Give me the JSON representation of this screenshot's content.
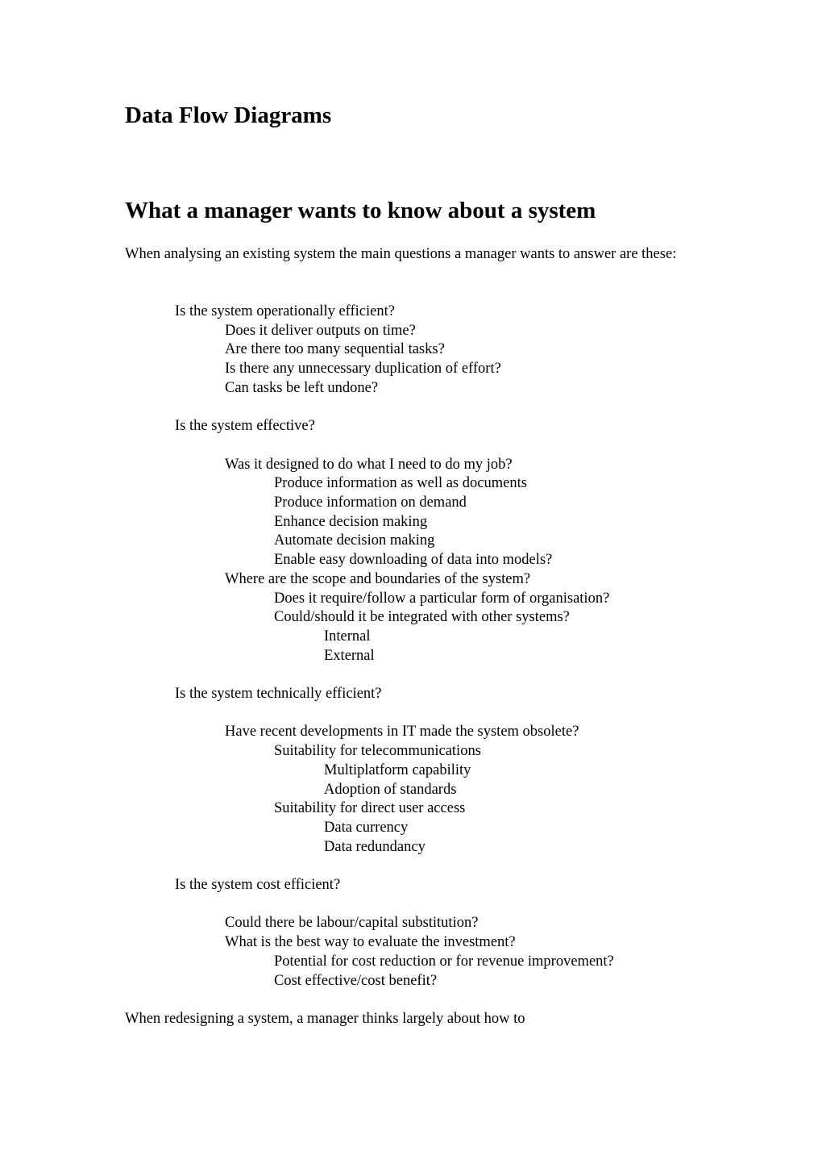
{
  "document": {
    "title": "Data Flow Diagrams",
    "section_heading": "What a manager wants to know about a system",
    "intro": "When analysing an existing system the main questions a manager wants to answer are these:",
    "outline": [
      {
        "level": 1,
        "line": 0,
        "text": "Is the system operationally efficient?"
      },
      {
        "level": 2,
        "line": 1,
        "text": "Does it deliver outputs on time?"
      },
      {
        "level": 2,
        "line": 2,
        "text": "Are there too many sequential tasks?"
      },
      {
        "level": 2,
        "line": 3,
        "text": "Is there any unnecessary duplication of effort?"
      },
      {
        "level": 2,
        "line": 4,
        "text": "Can tasks be left undone?"
      },
      {
        "level": 1,
        "line": 6,
        "text": "Is the system effective?"
      },
      {
        "level": 2,
        "line": 8,
        "text": "Was it designed to do what I need to do my job?"
      },
      {
        "level": 3,
        "line": 9,
        "text": "Produce information as well as documents"
      },
      {
        "level": 3,
        "line": 10,
        "text": "Produce information on demand"
      },
      {
        "level": 3,
        "line": 11,
        "text": "Enhance decision making"
      },
      {
        "level": 3,
        "line": 12,
        "text": "Automate decision making"
      },
      {
        "level": 3,
        "line": 13,
        "text": "Enable easy downloading of data into models?"
      },
      {
        "level": 2,
        "line": 14,
        "text": "Where are the scope and boundaries of the system?"
      },
      {
        "level": 3,
        "line": 15,
        "text": "Does it require/follow a particular form of organisation?"
      },
      {
        "level": 3,
        "line": 16,
        "text": "Could/should it be integrated with other systems?"
      },
      {
        "level": 4,
        "line": 17,
        "text": "Internal"
      },
      {
        "level": 4,
        "line": 18,
        "text": "External"
      },
      {
        "level": 1,
        "line": 20,
        "text": "Is the system technically efficient?"
      },
      {
        "level": 2,
        "line": 22,
        "text": "Have recent developments in IT made the system obsolete?"
      },
      {
        "level": 3,
        "line": 23,
        "text": "Suitability for telecommunications"
      },
      {
        "level": 4,
        "line": 24,
        "text": "Multiplatform capability"
      },
      {
        "level": 4,
        "line": 25,
        "text": "Adoption of standards"
      },
      {
        "level": 3,
        "line": 26,
        "text": "Suitability for direct user access"
      },
      {
        "level": 4,
        "line": 27,
        "text": "Data currency"
      },
      {
        "level": 4,
        "line": 28,
        "text": "Data redundancy"
      },
      {
        "level": 1,
        "line": 30,
        "text": "Is the system cost efficient?"
      },
      {
        "level": 2,
        "line": 32,
        "text": "Could there be labour/capital substitution?"
      },
      {
        "level": 2,
        "line": 33,
        "text": "What is the best way to evaluate the investment?"
      },
      {
        "level": 3,
        "line": 34,
        "text": "Potential for cost reduction or for revenue improvement?"
      },
      {
        "level": 3,
        "line": 35,
        "text": "Cost effective/cost benefit?"
      },
      {
        "level": 0,
        "line": 37,
        "text": "When redesigning a system, a manager thinks largely about how to"
      }
    ]
  }
}
